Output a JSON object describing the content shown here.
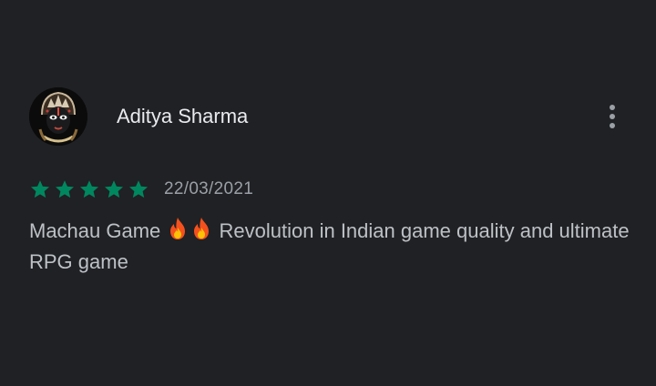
{
  "review": {
    "author": "Aditya Sharma",
    "rating": 5,
    "max_rating": 5,
    "date": "22/03/2021",
    "text_before_emoji": "Machau Game ",
    "text_after_emoji": " Revolution in Indian game quality and ultimate RPG game",
    "emoji": "fire-icon",
    "emoji_count": 2
  },
  "icons": {
    "avatar": "avatar-image",
    "star": "star-icon",
    "more": "more-vert-icon"
  },
  "colors": {
    "background": "#202124",
    "name": "#e8eaed",
    "body_text": "#bdc1c6",
    "secondary_text": "#9aa0a6",
    "star": "#01875f"
  }
}
